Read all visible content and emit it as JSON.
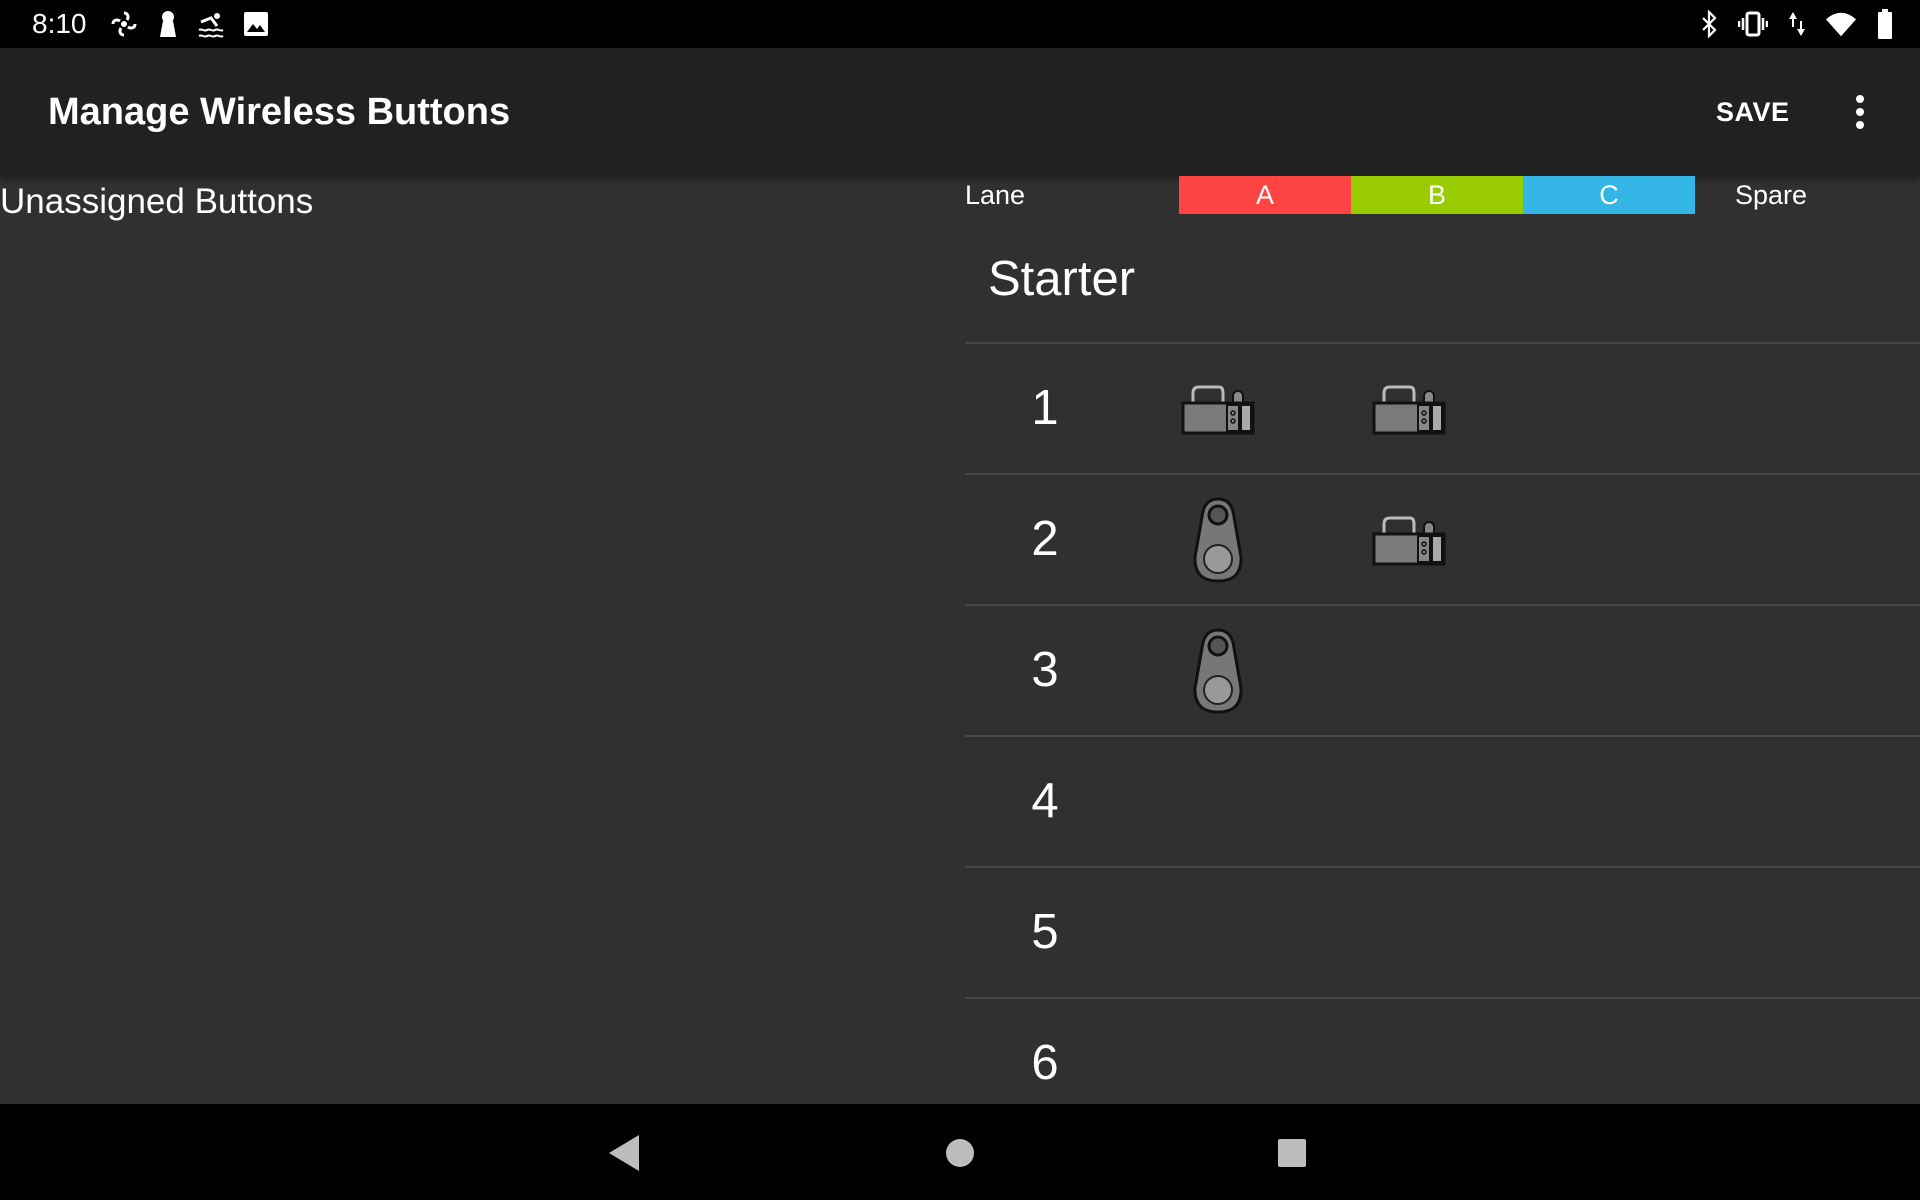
{
  "status_bar": {
    "time": "8:10",
    "left_icons": [
      "fan-icon",
      "keyhole-icon",
      "swimmer-icon",
      "image-icon"
    ],
    "right_icons": [
      "bluetooth-icon",
      "vibrate-icon",
      "data-arrows-icon",
      "wifi-icon",
      "battery-icon"
    ]
  },
  "app_bar": {
    "title": "Manage Wireless Buttons",
    "save_label": "SAVE",
    "menu_icon": "more-vert-icon"
  },
  "unassigned": {
    "title": "Unassigned Buttons"
  },
  "lanes_header": {
    "lane_label": "Lane",
    "columns": [
      {
        "label": "A",
        "color": "#ff4444"
      },
      {
        "label": "B",
        "color": "#99cc00"
      },
      {
        "label": "C",
        "color": "#33b5e5"
      }
    ],
    "spare_label": "Spare"
  },
  "starter_label": "Starter",
  "rows": [
    {
      "lane": "1",
      "a": "plunger-button-icon",
      "b": "plunger-button-icon"
    },
    {
      "lane": "2",
      "a": "push-button-icon",
      "b": "plunger-button-icon"
    },
    {
      "lane": "3",
      "a": "push-button-icon",
      "b": ""
    },
    {
      "lane": "4",
      "a": "",
      "b": ""
    },
    {
      "lane": "5",
      "a": "",
      "b": ""
    },
    {
      "lane": "6",
      "a": "",
      "b": ""
    }
  ],
  "nav_bar": {
    "icons": [
      "back-icon",
      "home-icon",
      "recents-icon"
    ]
  }
}
